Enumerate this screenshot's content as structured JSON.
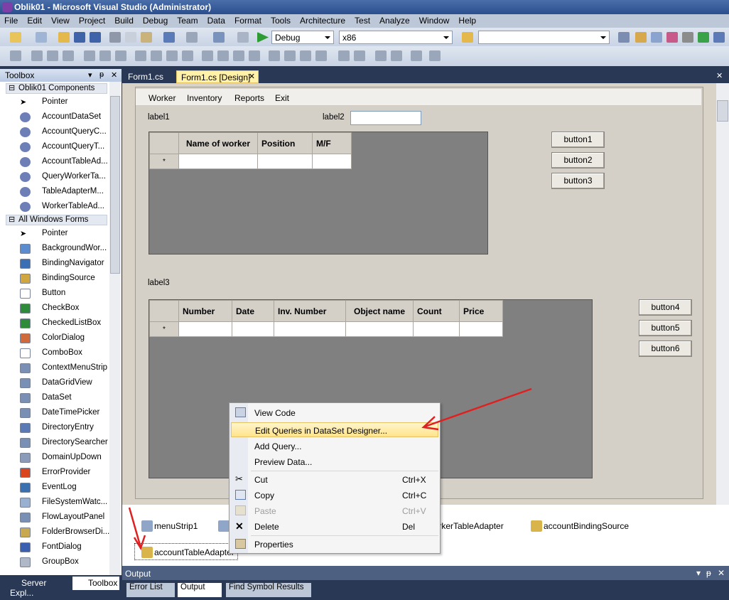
{
  "window": {
    "title": "Oblik01 - Microsoft Visual Studio (Administrator)"
  },
  "menubar": [
    "File",
    "Edit",
    "View",
    "Project",
    "Build",
    "Debug",
    "Team",
    "Data",
    "Format",
    "Tools",
    "Architecture",
    "Test",
    "Analyze",
    "Window",
    "Help"
  ],
  "toolbar": {
    "config": "Debug",
    "platform": "x86",
    "search": ""
  },
  "toolbox": {
    "title": "Toolbox",
    "group1": "Oblik01 Components",
    "group1_items": [
      "Pointer",
      "AccountDataSet",
      "AccountQueryC...",
      "AccountQueryT...",
      "AccountTableAd...",
      "QueryWorkerTa...",
      "TableAdapterM...",
      "WorkerTableAd..."
    ],
    "group2": "All Windows Forms",
    "group2_items": [
      "Pointer",
      "BackgroundWor...",
      "BindingNavigator",
      "BindingSource",
      "Button",
      "CheckBox",
      "CheckedListBox",
      "ColorDialog",
      "ComboBox",
      "ContextMenuStrip",
      "DataGridView",
      "DataSet",
      "DateTimePicker",
      "DirectoryEntry",
      "DirectorySearcher",
      "DomainUpDown",
      "ErrorProvider",
      "EventLog",
      "FileSystemWatc...",
      "FlowLayoutPanel",
      "FolderBrowserDi...",
      "FontDialog",
      "GroupBox"
    ],
    "bottom_tabs": [
      "Server Expl...",
      "Toolbox"
    ]
  },
  "doc_tabs": [
    "Form1.cs",
    "Form1.cs [Design]"
  ],
  "form": {
    "menu": [
      "Worker",
      "Inventory",
      "Reports",
      "Exit"
    ],
    "label1": "label1",
    "label2": "label2",
    "label3": "label3",
    "grid1_columns": [
      "Name of worker",
      "Position",
      "M/F"
    ],
    "grid2_columns": [
      "Number",
      "Date",
      "Inv. Number",
      "Object name",
      "Count",
      "Price"
    ],
    "new_row_marker": "*",
    "buttons": [
      "button1",
      "button2",
      "button3",
      "button4",
      "button5",
      "button6"
    ]
  },
  "tray": {
    "items": [
      "menuStrip1",
      "workerTableAdapter",
      "accountBindingSource",
      "accountTableAdapter"
    ]
  },
  "context_menu": {
    "items": [
      {
        "label": "View Code",
        "shortcut": ""
      },
      {
        "label": "Edit Queries in DataSet Designer...",
        "shortcut": ""
      },
      {
        "label": "Add Query...",
        "shortcut": ""
      },
      {
        "label": "Preview Data...",
        "shortcut": ""
      },
      {
        "label": "Cut",
        "shortcut": "Ctrl+X"
      },
      {
        "label": "Copy",
        "shortcut": "Ctrl+C"
      },
      {
        "label": "Paste",
        "shortcut": "Ctrl+V"
      },
      {
        "label": "Delete",
        "shortcut": "Del"
      },
      {
        "label": "Properties",
        "shortcut": ""
      }
    ]
  },
  "output": {
    "title": "Output",
    "tabs": [
      "Error List",
      "Output",
      "Find Symbol Results"
    ]
  },
  "colors": {
    "highlight": "#ffe48a",
    "annotation_arrow": "#e02020"
  }
}
